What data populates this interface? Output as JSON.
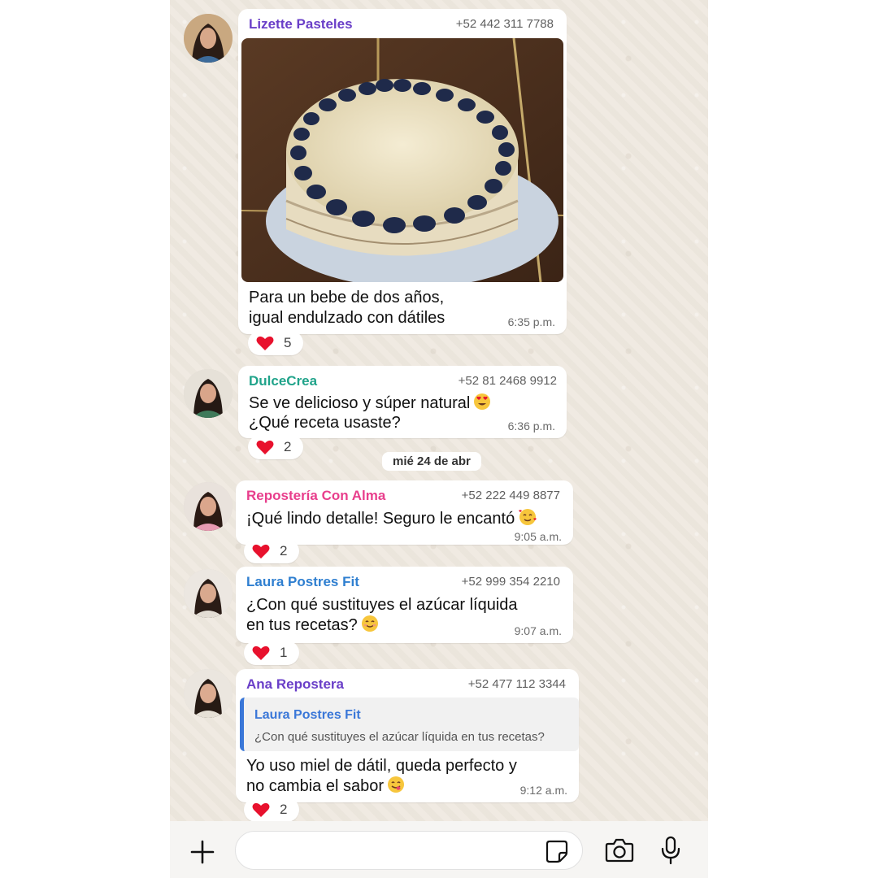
{
  "messages": [
    {
      "sender": "Lizette Pasteles",
      "phone": "+52 442 311 7788",
      "sender_color": "#6a3fc8",
      "has_photo": true,
      "lines": [
        "Para un bebe de dos años,",
        "igual endulzado con dátiles"
      ],
      "time": "6:35 p.m.",
      "reaction_count": "5"
    },
    {
      "sender": "DulceCrea",
      "phone": "+52 81 2468 9912",
      "sender_color": "#20a38a",
      "lines": [
        "Se ve delicioso y súper natural",
        "¿Qué receta usaste?"
      ],
      "time": "6:36 p.m.",
      "reaction_count": "2"
    },
    {
      "sender": "Repostería Con Alma",
      "phone": "+52 222 449 8877",
      "sender_color": "#e83e8c",
      "lines": [
        "¡Qué lindo detalle! Seguro le encantó"
      ],
      "time": "9:05 a.m.",
      "reaction_count": "2"
    },
    {
      "sender": "Laura Postres Fit",
      "phone": "+52 999 354 2210",
      "sender_color": "#2f7fd0",
      "lines": [
        "¿Con qué sustituyes el azúcar líquida",
        "en tus recetas?"
      ],
      "time": "9:07 a.m.",
      "reaction_count": "1"
    },
    {
      "sender": "Ana Repostera",
      "phone": "+52 477 112 3344",
      "sender_color": "#6a3fc8",
      "quote": {
        "name": "Laura Postres Fit",
        "text": "¿Con qué sustituyes el azúcar líquida en tus recetas?"
      },
      "lines": [
        "Yo uso miel de dátil, queda perfecto y",
        "no cambia el sabor"
      ],
      "time": "9:12 a.m.",
      "reaction_count": "2"
    }
  ],
  "date_separator": "mié 24 de abr",
  "reaction_emoji": "red-heart",
  "icons": {
    "attach": "plus-icon",
    "sticker": "sticker-icon",
    "camera": "camera-icon",
    "mic": "microphone-icon"
  },
  "colors": {
    "chat_background": "#efe9e0",
    "bubble": "#ffffff",
    "heart": "#e8112d",
    "quote_bar": "#3a77d8"
  }
}
